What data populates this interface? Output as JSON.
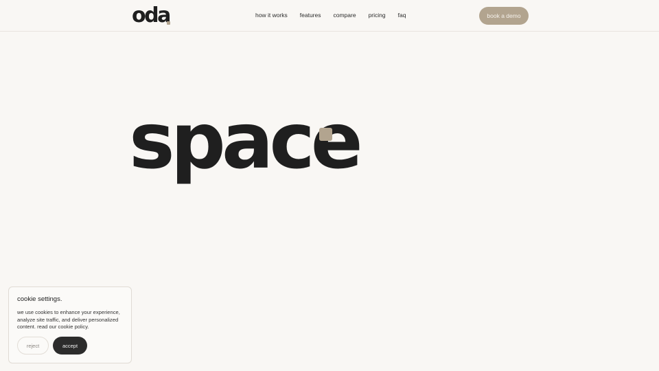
{
  "header": {
    "logo": "oda",
    "nav": [
      "how it works",
      "features",
      "compare",
      "pricing",
      "faq"
    ],
    "cta_label": "book a demo"
  },
  "hero": {
    "wordmark": "space"
  },
  "cookie_banner": {
    "title": "cookie settings.",
    "body": "we use cookies to enhance your experience, analyze site traffic, and deliver personalized content. read our cookie policy.",
    "reject_label": "reject",
    "accept_label": "accept"
  },
  "colors": {
    "background": "#f9f7f4",
    "accent": "#b2a48f",
    "text": "#1f1f1f",
    "button_dark": "#2c2c2c"
  }
}
